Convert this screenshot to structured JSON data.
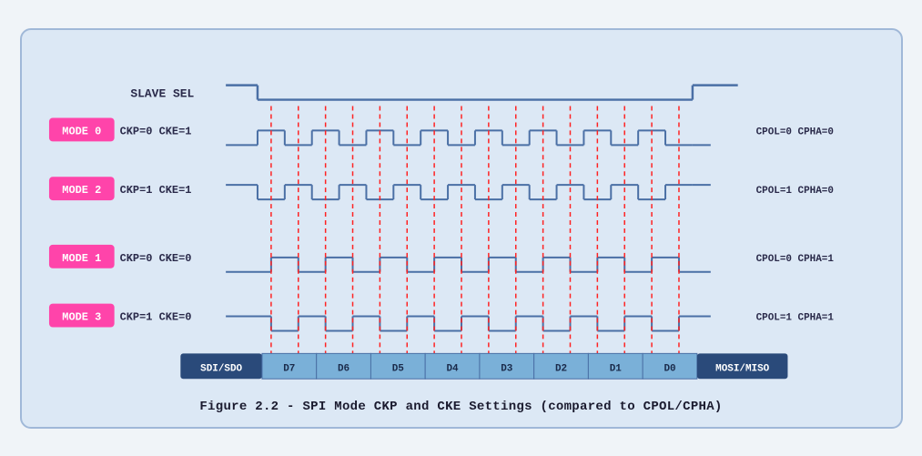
{
  "caption": "Figure 2.2 - SPI Mode CKP and CKE Settings (compared to CPOL/CPHA)",
  "diagram": {
    "slave_sel_label": "SLAVE SEL",
    "modes": [
      {
        "label": "MODE 0",
        "ckp_cke": "CKP=0  CKE=1",
        "cpol_cpha": "CPOL=0  CPHA=0"
      },
      {
        "label": "MODE 2",
        "ckp_cke": "CKP=1  CKE=1",
        "cpol_cpha": "CPOL=1  CPHA=0"
      },
      {
        "label": "MODE 1",
        "ckp_cke": "CKP=0  CKE=0",
        "cpol_cpha": "CPOL=0  CPHA=1"
      },
      {
        "label": "MODE 3",
        "ckp_cke": "CKP=1  CKE=0",
        "cpol_cpha": "CPOL=1  CPHA=1"
      }
    ],
    "data_bits": [
      "SDI/SDO",
      "D7",
      "D6",
      "D5",
      "D4",
      "D3",
      "D2",
      "D1",
      "D0",
      "MOSI/MISO"
    ]
  }
}
